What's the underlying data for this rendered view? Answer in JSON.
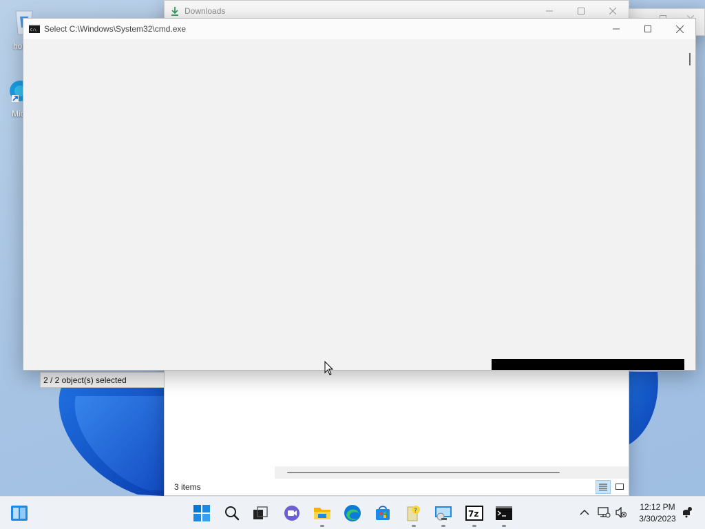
{
  "desktop": {
    "icons": [
      {
        "name": "recycle-bin-icon",
        "label": "hold c"
      },
      {
        "name": "edge-shortcut-icon",
        "label": "Micr Ec"
      }
    ]
  },
  "windows": {
    "back": {
      "controls": [
        "minimize-icon",
        "maximize-icon",
        "close-icon"
      ]
    },
    "downloads": {
      "title": "Downloads",
      "status_text": "3 items",
      "views": [
        {
          "name": "details-view-icon",
          "active": true
        },
        {
          "name": "large-icons-view-icon",
          "active": false
        }
      ]
    },
    "seven_zip": {
      "status_text": "2 / 2 object(s) selected"
    },
    "cmd": {
      "title": "Select C:\\Windows\\System32\\cmd.exe"
    }
  },
  "taskbar": {
    "apps": [
      {
        "name": "start-icon",
        "running": false
      },
      {
        "name": "search-icon",
        "running": false
      },
      {
        "name": "task-view-icon",
        "running": false
      },
      {
        "name": "chat-icon",
        "running": false
      },
      {
        "name": "file-explorer-icon",
        "running": true
      },
      {
        "name": "edge-icon",
        "running": false
      },
      {
        "name": "store-icon",
        "running": false
      },
      {
        "name": "tips-icon",
        "running": true
      },
      {
        "name": "remote-desktop-icon",
        "running": true
      },
      {
        "name": "7zip-icon",
        "running": true
      },
      {
        "name": "cmd-icon",
        "running": true
      }
    ],
    "tray": {
      "icons": [
        "chevron-up-icon",
        "network-icon",
        "volume-muted-icon"
      ],
      "time": "12:12 PM",
      "date": "3/30/2023",
      "notification_icon": "notification-icon"
    },
    "widgets_icon": "widgets-icon"
  },
  "colors": {
    "accent": "#0067c0",
    "taskbar_bg": "#eef2f6",
    "cmd_body": "#f2f2f2"
  }
}
